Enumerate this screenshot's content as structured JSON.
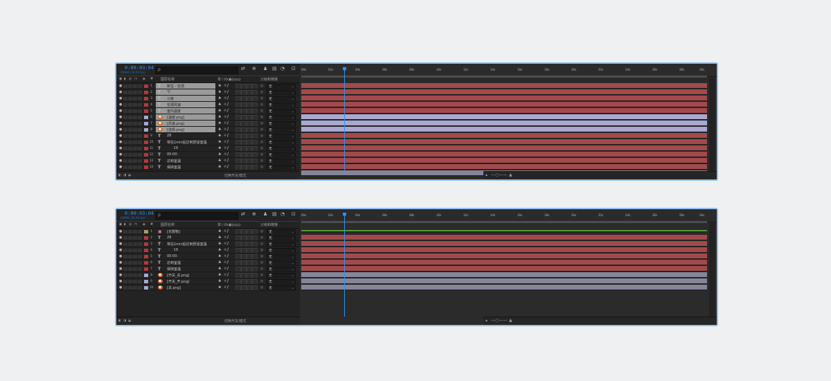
{
  "panels": [
    {
      "timecode": "0:00:03:04",
      "fps": "00094 (30.00 fps)",
      "search_placeholder": "ρ",
      "header": {
        "name_label": "图层名称",
        "switches_label": "单☆\\fx▣◎◎◎",
        "parent_label": "父级和链接",
        "hash": "#"
      },
      "toggle_label": "切换开关/模式",
      "ruler_labels": [
        "00s",
        "02s",
        "04s",
        "06s",
        "08s",
        "10s",
        "12s",
        "14s",
        "16s",
        "18s",
        "20s",
        "22s",
        "24s",
        "26s",
        "28s",
        "30s"
      ],
      "current_time_fraction": 0.106,
      "layers": [
        {
          "num": "1",
          "type": "T",
          "name": "新宝 - 空调",
          "label_color": "#b33a3a",
          "parent": "无",
          "bar": "red",
          "selected": true
        },
        {
          "num": "2",
          "type": "T",
          "name": "℃",
          "label_color": "#b33a3a",
          "parent": "无",
          "bar": "red",
          "selected": true
        },
        {
          "num": "3",
          "type": "T",
          "name": "三级",
          "label_color": "#b33a3a",
          "parent": "无",
          "bar": "red",
          "selected": true
        },
        {
          "num": "4",
          "type": "T",
          "name": "空调风速",
          "label_color": "#b33a3a",
          "parent": "无",
          "bar": "red",
          "selected": true
        },
        {
          "num": "5",
          "type": "T",
          "name": "室内温度",
          "label_color": "#b33a3a",
          "parent": "无",
          "bar": "red",
          "selected": true
        },
        {
          "num": "6",
          "type": "img",
          "name": "[温度.png]",
          "label_color": "#a8a8d0",
          "parent": "无",
          "bar": "purple",
          "selected": true
        },
        {
          "num": "7",
          "type": "img",
          "name": "[风速.png]",
          "label_color": "#a8a8d0",
          "parent": "无",
          "bar": "purple",
          "selected": true
        },
        {
          "num": "8",
          "type": "img",
          "name": "[选择.png]",
          "label_color": "#a8a8d0",
          "parent": "无",
          "bar": "purple",
          "selected": true
        },
        {
          "num": "9",
          "type": "T",
          "name": "28",
          "label_color": "#b33a3a",
          "parent": "无",
          "bar": "red",
          "selected": false
        },
        {
          "num": "10",
          "type": "T",
          "name": "将在1min后达到舒适室温",
          "label_color": "#b33a3a",
          "parent": "无",
          "bar": "red",
          "selected": false
        },
        {
          "num": "11",
          "type": "T",
          "name": "      19",
          "label_color": "#b33a3a",
          "parent": "无",
          "bar": "red",
          "selected": false
        },
        {
          "num": "12",
          "type": "T",
          "name": "00:00:",
          "label_color": "#b33a3a",
          "parent": "无",
          "bar": "red",
          "selected": false
        },
        {
          "num": "13",
          "type": "T",
          "name": "达到室温",
          "label_color": "#b33a3a",
          "parent": "无",
          "bar": "red",
          "selected": false
        },
        {
          "num": "14",
          "type": "T",
          "name": "保持室温",
          "label_color": "#b33a3a",
          "parent": "无",
          "bar": "red",
          "selected": false
        },
        {
          "num": "15",
          "type": "img",
          "name": "[开关_开.png]",
          "label_color": "#a8a8d0",
          "parent": "无",
          "bar": "gray",
          "selected": false
        }
      ]
    },
    {
      "timecode": "0:00:03:04",
      "fps": "00094 (30.00 fps)",
      "search_placeholder": "ρ",
      "header": {
        "name_label": "图层名称",
        "switches_label": "单☆\\fx▣◎◎◎",
        "parent_label": "父级和链接",
        "hash": "#"
      },
      "toggle_label": "切换开关/模式",
      "ruler_labels": [
        "00s",
        "02s",
        "04s",
        "06s",
        "08s",
        "10s",
        "12s",
        "14s",
        "16s",
        "18s",
        "20s",
        "22s",
        "24s",
        "26s",
        "28s",
        "30s"
      ],
      "current_time_fraction": 0.106,
      "layers": [
        {
          "num": "1",
          "type": "solid",
          "name": "[无题物]",
          "label_color": "#a89a6a",
          "parent": "无",
          "bar": "green",
          "selected": false
        },
        {
          "num": "2",
          "type": "T",
          "name": "28",
          "label_color": "#b33a3a",
          "parent": "无",
          "bar": "red",
          "selected": false
        },
        {
          "num": "3",
          "type": "T",
          "name": "将在1min后达到舒适室温",
          "label_color": "#b33a3a",
          "parent": "无",
          "bar": "red",
          "selected": false
        },
        {
          "num": "4",
          "type": "T",
          "name": "      19",
          "label_color": "#b33a3a",
          "parent": "无",
          "bar": "red",
          "selected": false
        },
        {
          "num": "5",
          "type": "T",
          "name": "00:00:",
          "label_color": "#b33a3a",
          "parent": "无",
          "bar": "red",
          "selected": false
        },
        {
          "num": "6",
          "type": "T",
          "name": "达到室温",
          "label_color": "#b33a3a",
          "parent": "无",
          "bar": "red",
          "selected": false
        },
        {
          "num": "7",
          "type": "T",
          "name": "保持室温",
          "label_color": "#b33a3a",
          "parent": "无",
          "bar": "red",
          "selected": false
        },
        {
          "num": "8",
          "type": "img",
          "name": "[开关_关.png]",
          "label_color": "#a8a8d0",
          "parent": "无",
          "bar": "gray",
          "selected": false
        },
        {
          "num": "9",
          "type": "img",
          "name": "[开关_开.png]",
          "label_color": "#a8a8d0",
          "parent": "无",
          "bar": "gray",
          "selected": false
        },
        {
          "num": "10",
          "type": "img",
          "name": "[关.png]",
          "label_color": "#a8a8d0",
          "parent": "无",
          "bar": "gray",
          "selected": false
        }
      ]
    }
  ]
}
